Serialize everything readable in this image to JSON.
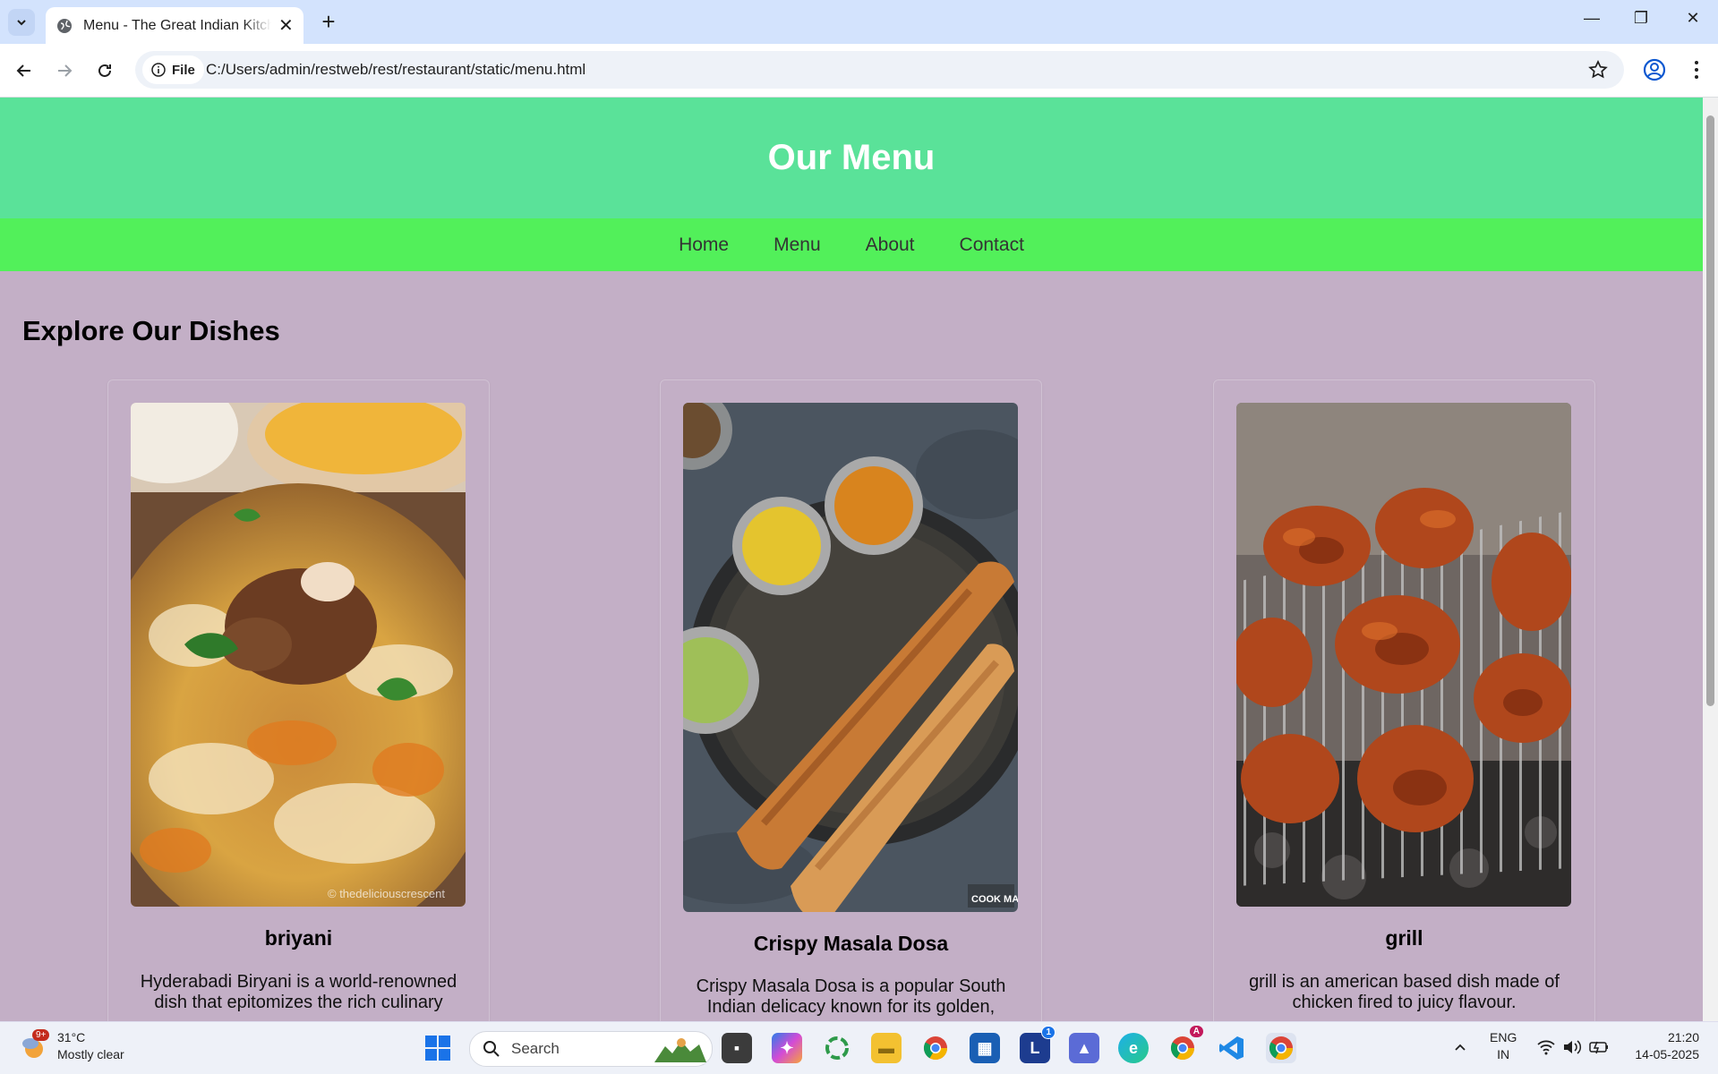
{
  "browser": {
    "tab_title": "Menu - The Great Indian Kitchen",
    "site_chip_label": "File",
    "url": "C:/Users/admin/restweb/rest/restaurant/static/menu.html"
  },
  "page": {
    "header_title": "Our Menu",
    "nav": [
      "Home",
      "Menu",
      "About",
      "Contact"
    ],
    "section_title": "Explore Our Dishes",
    "dishes": [
      {
        "name": "briyani",
        "description": "Hyderabadi Biryani is a world-renowned dish that epitomizes the rich culinary heritage of Hyderabad. This aromatic rice",
        "image_watermark": "© thedeliciouscrescent"
      },
      {
        "name": "Crispy Masala Dosa",
        "description": "Crispy Masala Dosa is a popular South Indian delicacy known for its golden, crispy texture",
        "image_watermark": "COOK MANALI"
      },
      {
        "name": "grill",
        "description": "grill is an american based dish made of chicken fired to juicy flavour."
      }
    ]
  },
  "taskbar": {
    "weather_temp": "31°C",
    "weather_desc": "Mostly clear",
    "weather_badge": "9+",
    "search_placeholder": "Search",
    "lang_line1": "ENG",
    "lang_line2": "IN",
    "time": "21:20",
    "date": "14-05-2025",
    "l_app_badge": "1",
    "chrome_badge": "A"
  }
}
